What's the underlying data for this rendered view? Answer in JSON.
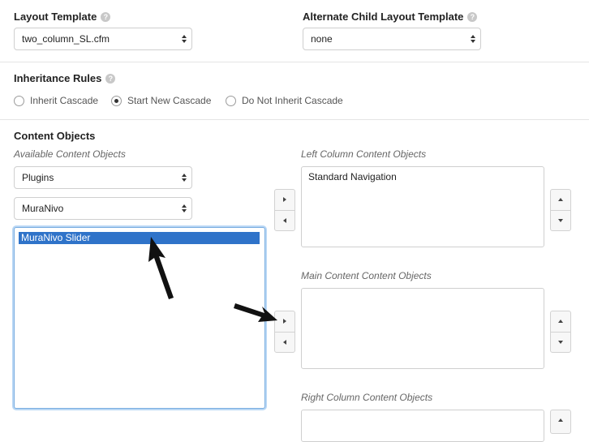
{
  "layout_template": {
    "label": "Layout Template",
    "help": "?",
    "value": "two_column_SL.cfm"
  },
  "alt_child_template": {
    "label": "Alternate Child Layout Template",
    "help": "?",
    "value": "none"
  },
  "inheritance": {
    "label": "Inheritance Rules",
    "help": "?",
    "options": [
      "Inherit Cascade",
      "Start New Cascade",
      "Do Not Inherit Cascade"
    ],
    "selected": "Start New Cascade"
  },
  "content_objects": {
    "heading": "Content Objects",
    "available_label": "Available Content Objects",
    "type_select": "Plugins",
    "plugin_select": "MuraNivo",
    "available_items": [
      "MuraNivo Slider"
    ],
    "left_label": "Left Column Content Objects",
    "left_items": [
      "Standard Navigation"
    ],
    "main_label": "Main Content Content Objects",
    "main_items": [],
    "right_label": "Right Column Content Objects",
    "right_items": []
  },
  "colors": {
    "selection": "#2f73c9",
    "focus_ring": "#b9d7f5"
  }
}
